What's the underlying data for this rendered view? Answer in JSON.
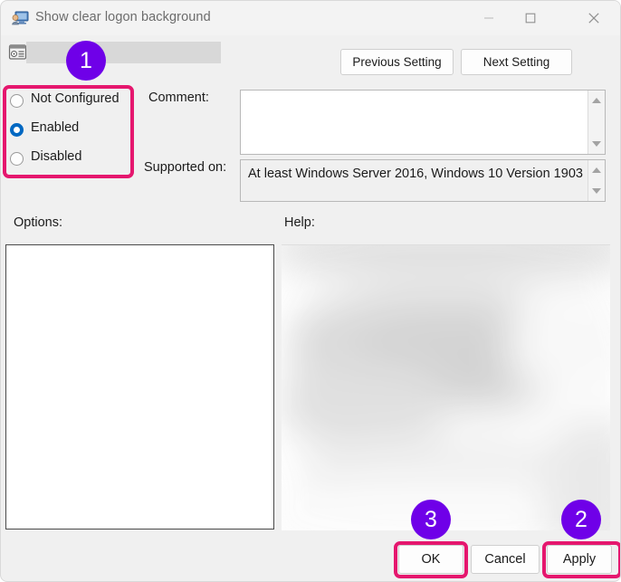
{
  "window": {
    "title": "Show clear logon background",
    "icon": "gpo-setting-icon",
    "controls": {
      "minimize": "minimize-icon",
      "maximize": "maximize-icon",
      "close": "close-icon"
    }
  },
  "setting_row": {
    "icon": "policy-setting-icon",
    "name": ""
  },
  "navigation": {
    "previous_label": "Previous Setting",
    "next_label": "Next Setting"
  },
  "state_options": [
    {
      "label": "Not Configured",
      "selected": false
    },
    {
      "label": "Enabled",
      "selected": true
    },
    {
      "label": "Disabled",
      "selected": false
    }
  ],
  "fields": {
    "comment_label": "Comment:",
    "comment_value": "",
    "supported_label": "Supported on:",
    "supported_value": "At least Windows Server 2016, Windows 10 Version 1903"
  },
  "panels": {
    "options_label": "Options:",
    "options_value": "",
    "help_label": "Help:",
    "help_value": ""
  },
  "dialog_buttons": {
    "ok": "OK",
    "cancel": "Cancel",
    "apply": "Apply"
  },
  "annotations": {
    "badge_1": "1",
    "badge_2": "2",
    "badge_3": "3",
    "highlight_color": "#e5176e",
    "badge_color": "#6f00e8"
  },
  "colors": {
    "window_background": "#f0f0f0",
    "titlebar_background": "#f3f3f3",
    "radio_accent": "#0068c2",
    "text": "#1b1b1b",
    "title_text": "#6c6c6c"
  }
}
